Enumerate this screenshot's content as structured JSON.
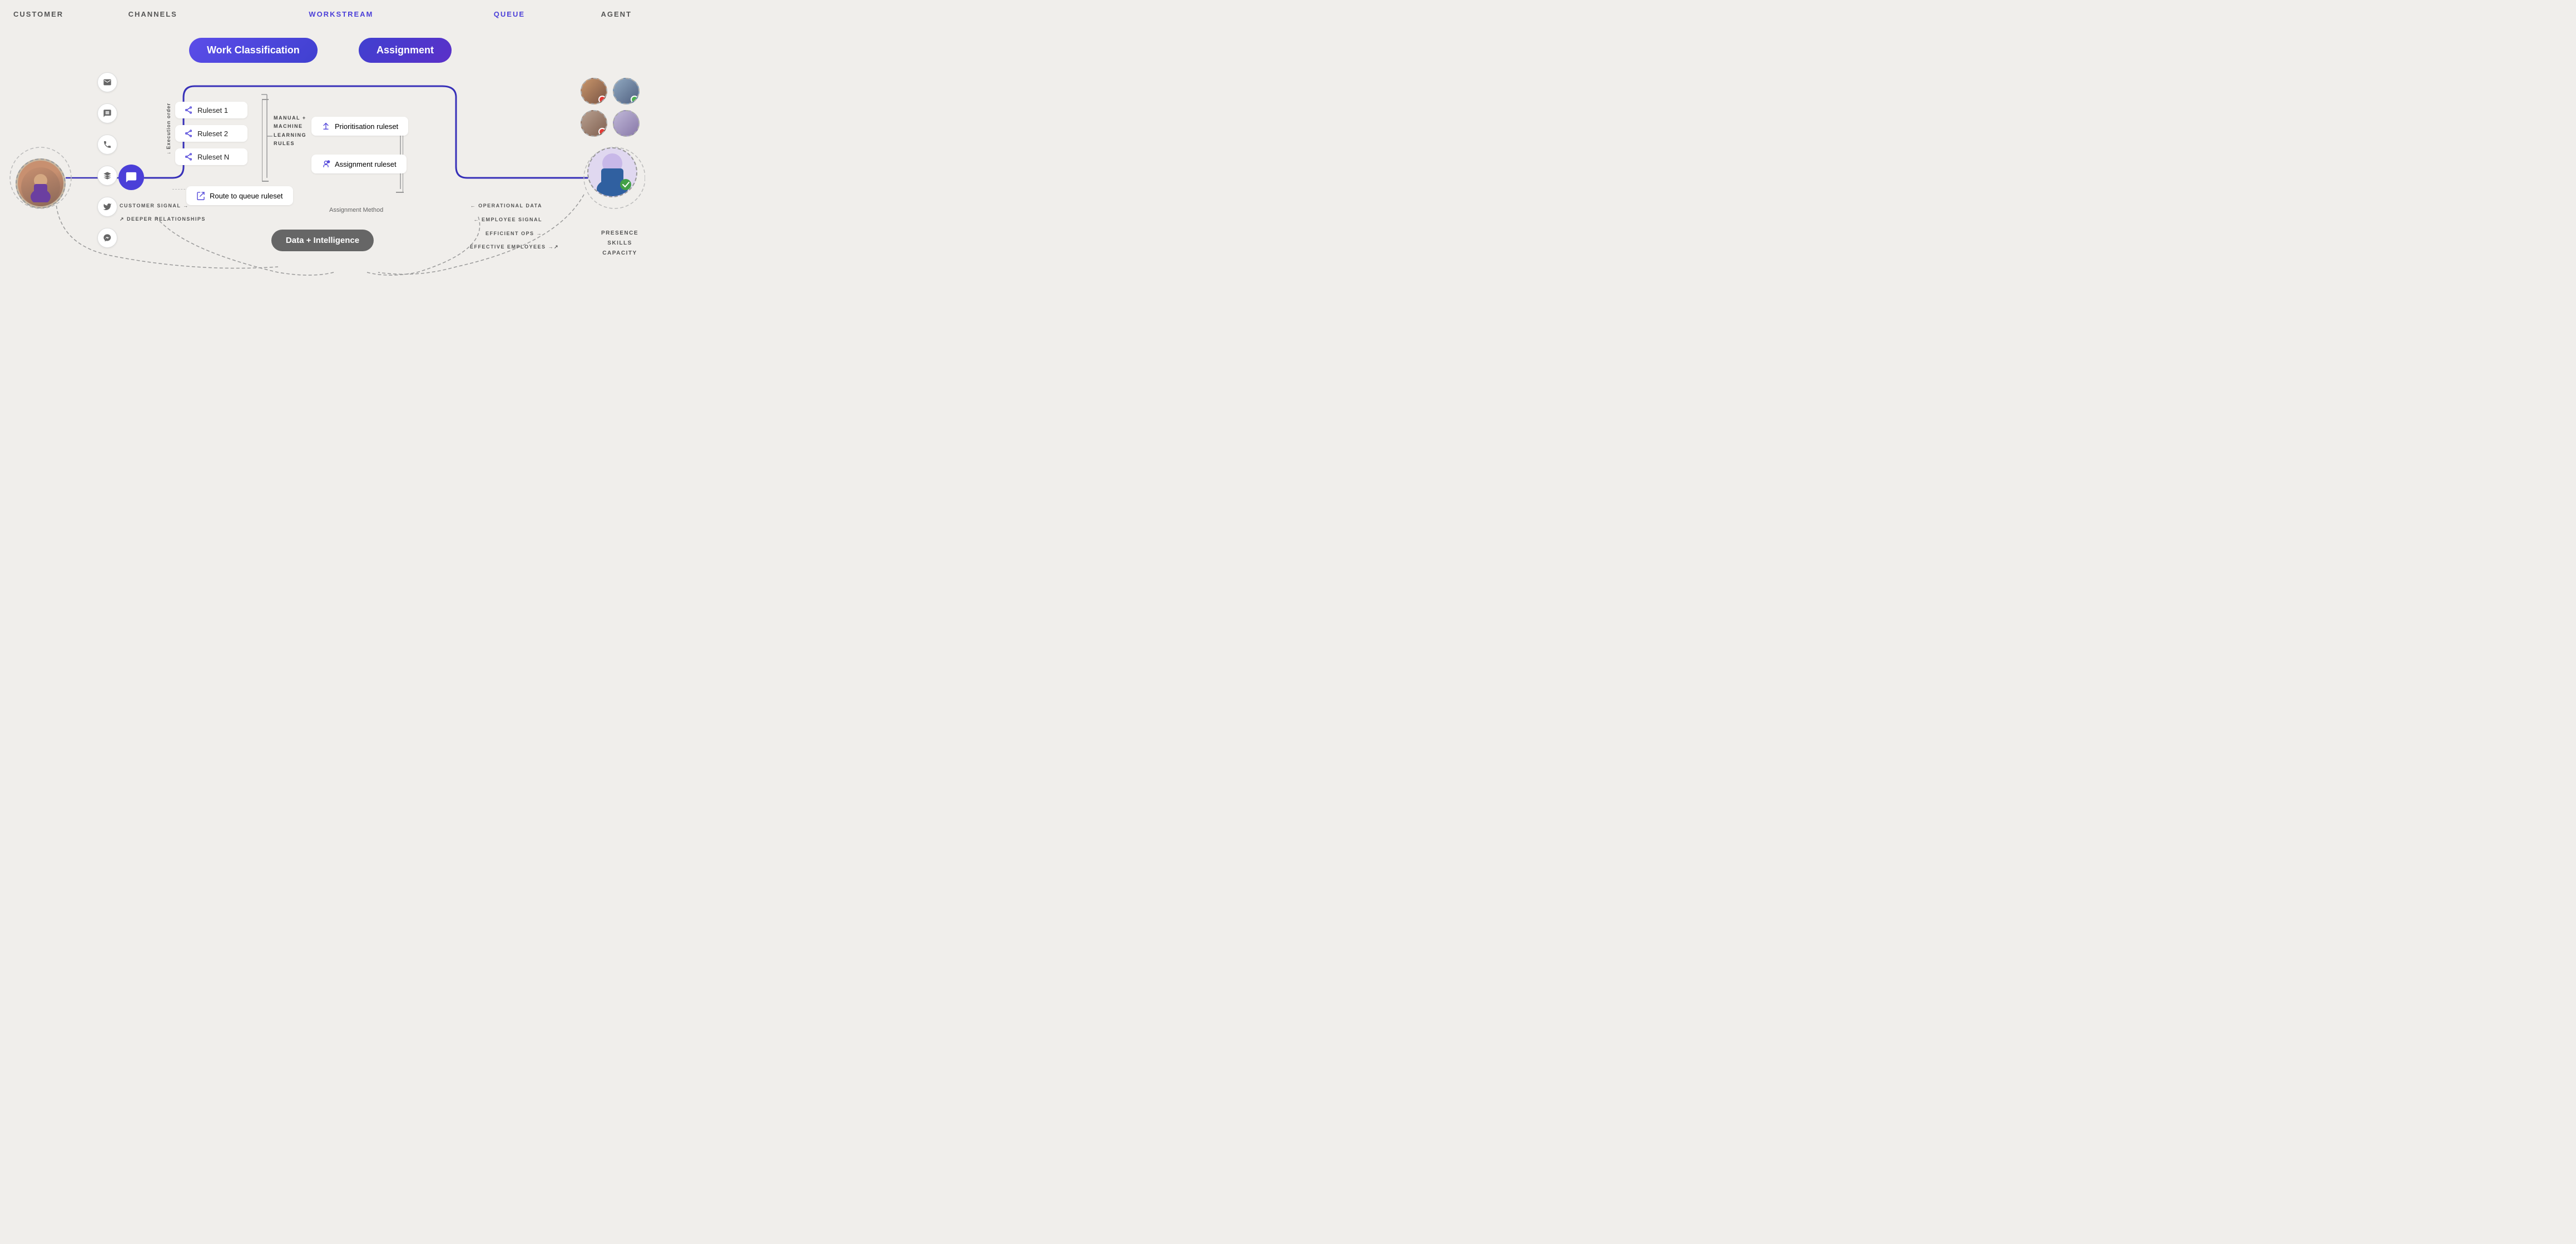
{
  "header": {
    "customer_label": "CUSTOMER",
    "channels_label": "CHANNELS",
    "workstream_label": "WORKSTREAM",
    "queue_label": "QUEUE",
    "agent_label": "AGENT"
  },
  "pills": {
    "work_classification": "Work Classification",
    "assignment": "Assignment"
  },
  "rulesets": [
    {
      "label": "Ruleset 1"
    },
    {
      "label": "Ruleset 2"
    },
    {
      "label": "Ruleset N"
    }
  ],
  "execution_order": "↓ Execution order",
  "ml_rules": "MANUAL +\nMACHINE\nLEARNING\nRULES",
  "route_queue": "Route to queue ruleset",
  "priority_ruleset": "Prioritisation ruleset",
  "assignment_ruleset": "Assignment ruleset",
  "assignment_method": "Assignment Method",
  "data_intelligence": "Data + Intelligence",
  "data_labels": {
    "customer_signal": "CUSTOMER SIGNAL →",
    "deeper_relationships": "↗ DEEPER RELATIONSHIPS",
    "operational_data": "← OPERATIONAL DATA",
    "employee_signal": "← EMPLOYEE SIGNAL",
    "efficient_ops": "EFFICIENT OPS →",
    "effective_employees": "EFFECTIVE EMPLOYEES →↗"
  },
  "agent_info": {
    "presence": "PRESENCE",
    "skills": "SKILLS",
    "capacity": "CAPACITY"
  },
  "channels": [
    {
      "icon": "✉",
      "name": "email"
    },
    {
      "icon": "💬",
      "name": "sms"
    },
    {
      "icon": "📞",
      "name": "phone"
    },
    {
      "icon": "⬡",
      "name": "object"
    },
    {
      "icon": "🐦",
      "name": "twitter"
    },
    {
      "icon": "💬",
      "name": "messenger"
    }
  ]
}
